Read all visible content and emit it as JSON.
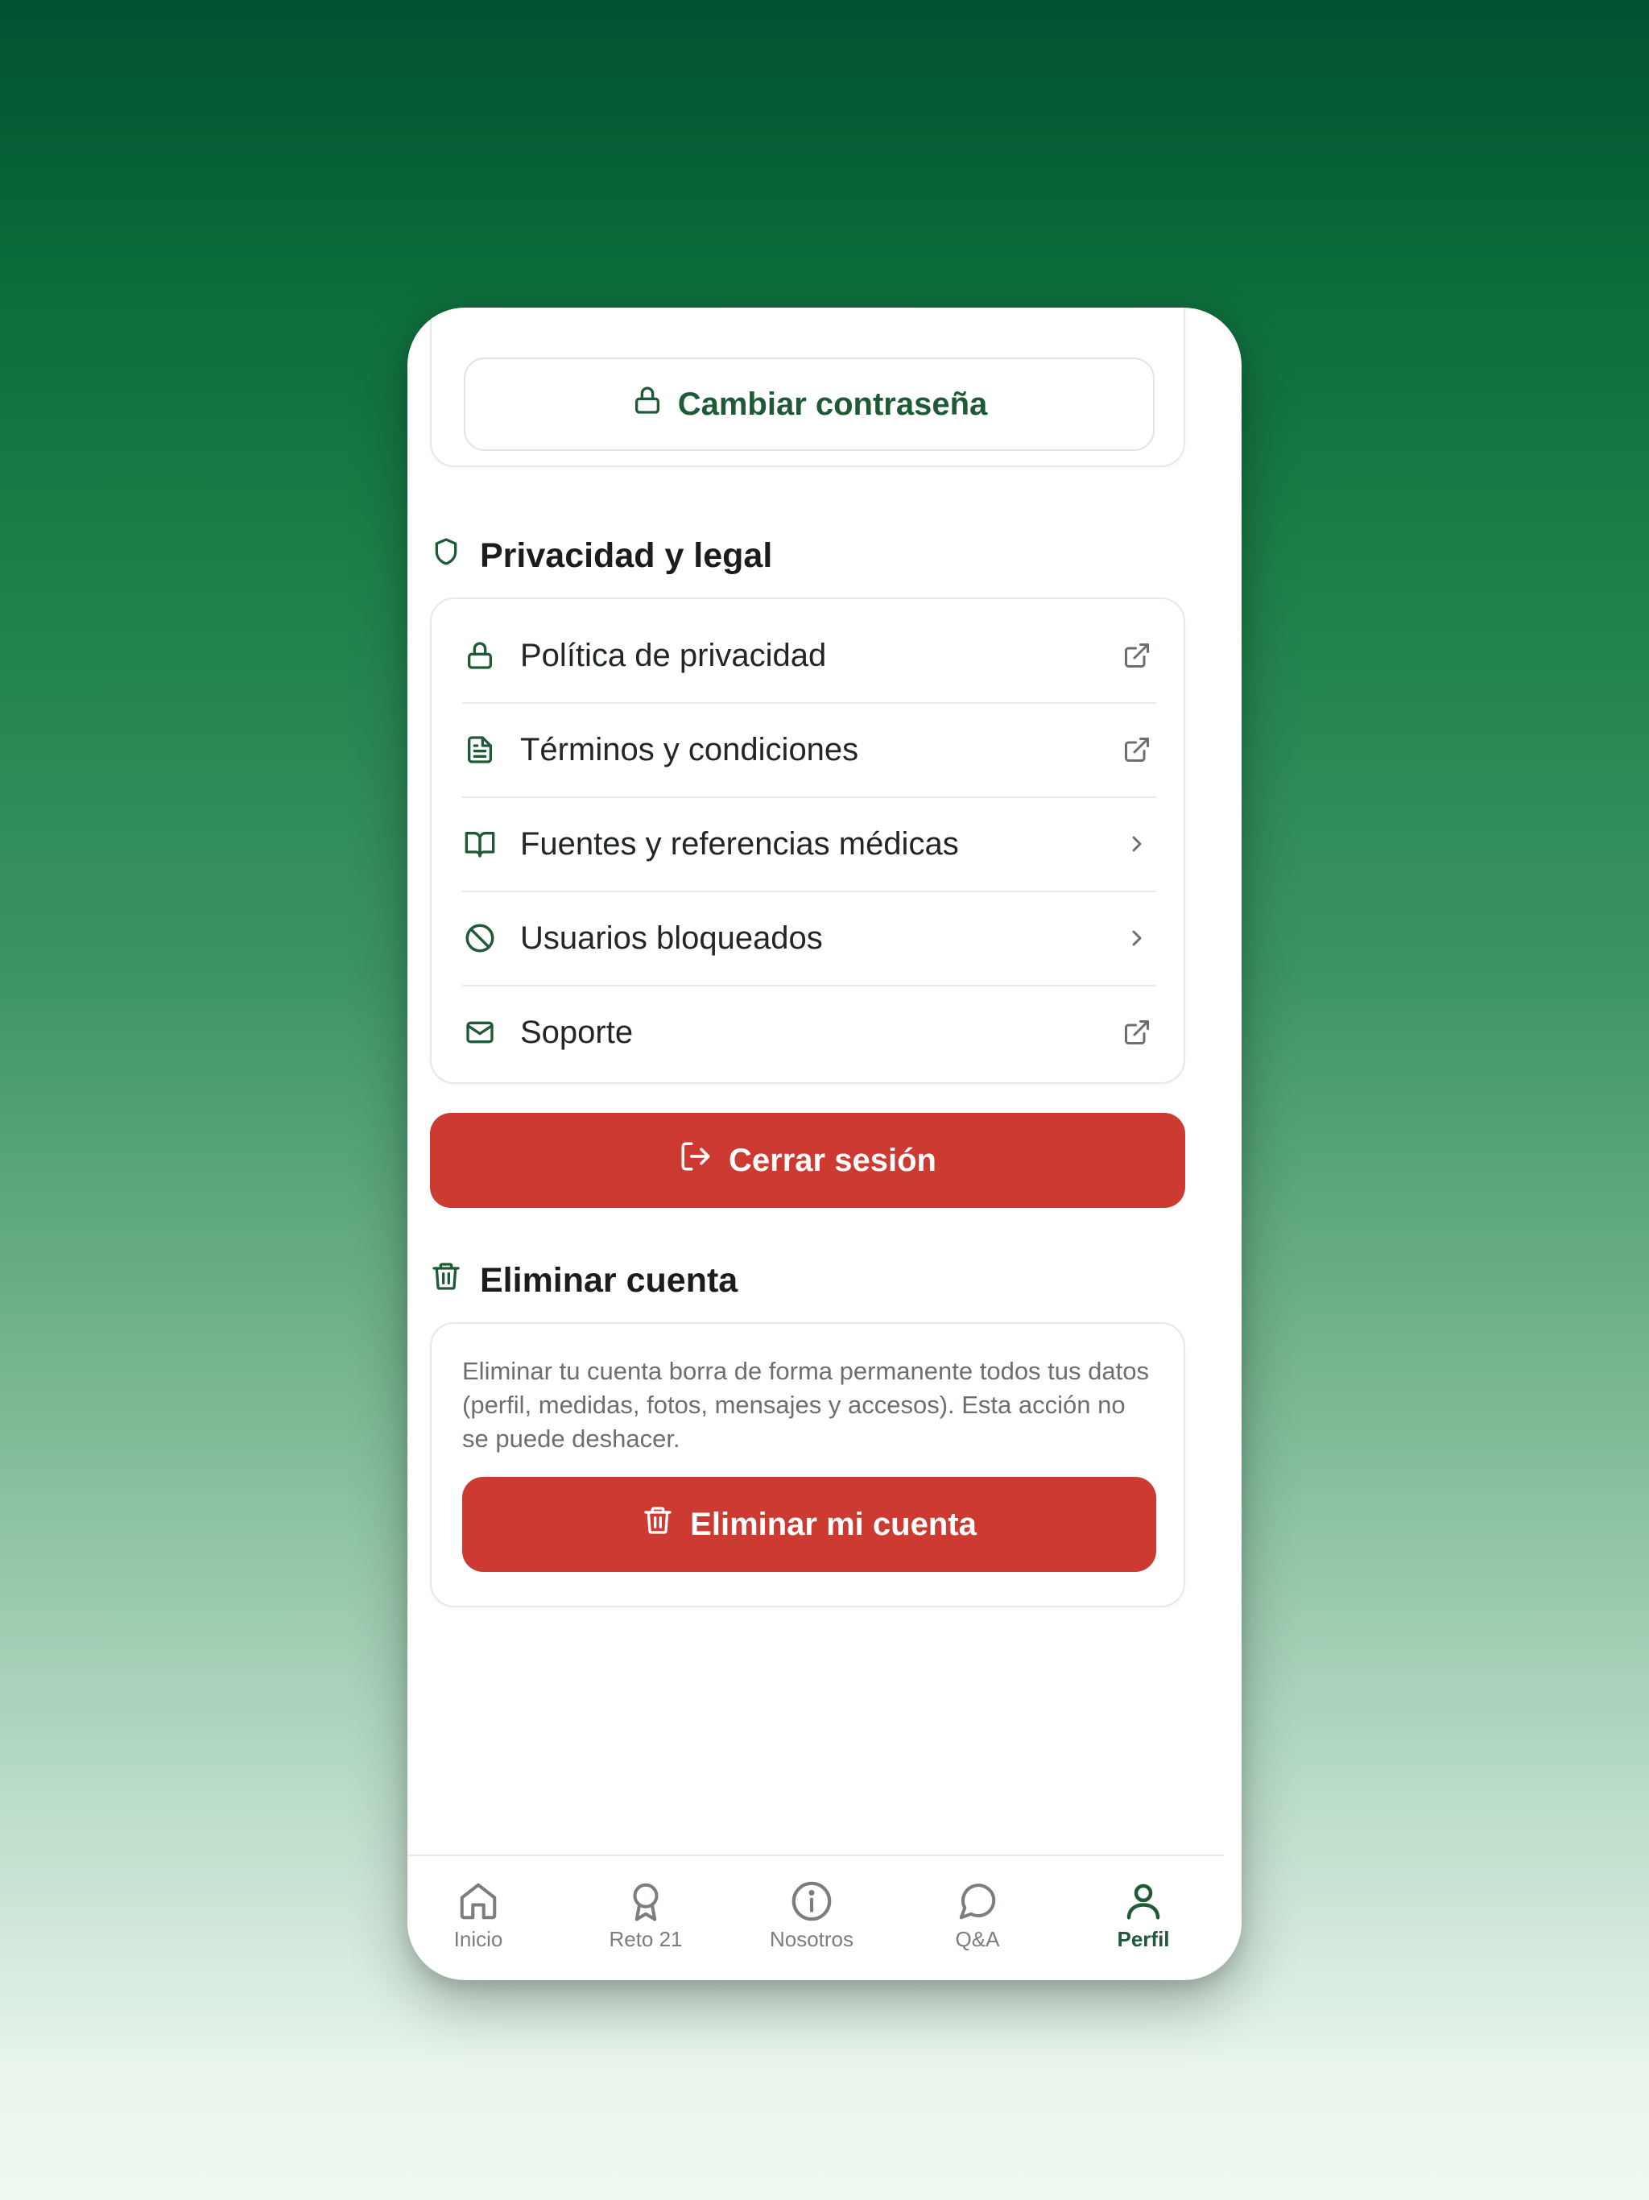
{
  "account": {
    "change_password_label": "Cambiar contraseña"
  },
  "privacy": {
    "title": "Privacidad y legal",
    "items": [
      {
        "label": "Política de privacidad",
        "icon": "lock-icon",
        "trail": "external-link-icon"
      },
      {
        "label": "Términos y condiciones",
        "icon": "document-icon",
        "trail": "external-link-icon"
      },
      {
        "label": "Fuentes y referencias médicas",
        "icon": "book-icon",
        "trail": "chevron-right-icon"
      },
      {
        "label": "Usuarios bloqueados",
        "icon": "block-icon",
        "trail": "chevron-right-icon"
      },
      {
        "label": "Soporte",
        "icon": "mail-icon",
        "trail": "external-link-icon"
      }
    ]
  },
  "logout": {
    "label": "Cerrar sesión"
  },
  "delete_account": {
    "title": "Eliminar cuenta",
    "description": "Eliminar tu cuenta borra de forma permanente todos tus datos (perfil, medidas, fotos, mensajes y accesos). Esta acción no se puede deshacer.",
    "button_label": "Eliminar mi cuenta"
  },
  "tabbar": {
    "tabs": [
      {
        "label": "Inicio",
        "icon": "home-icon"
      },
      {
        "label": "Reto 21",
        "icon": "award-icon"
      },
      {
        "label": "Nosotros",
        "icon": "info-icon"
      },
      {
        "label": "Q&A",
        "icon": "chat-icon"
      },
      {
        "label": "Perfil",
        "icon": "user-icon",
        "active": true
      }
    ]
  },
  "colors": {
    "brand_green": "#1f5a36",
    "danger_red": "#cc3a31"
  }
}
